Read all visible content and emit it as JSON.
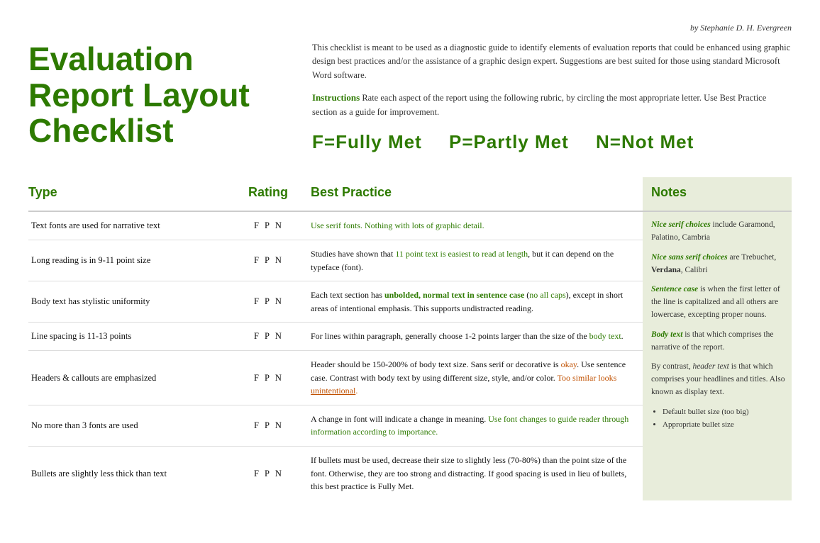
{
  "byline": "by Stephanie D. H. Evergreen",
  "title": {
    "line1": "Evaluation",
    "line2": "Report Layout",
    "line3": "Checklist"
  },
  "intro": {
    "description": "This checklist is meant to be used as a diagnostic guide to identify elements of evaluation reports that could be enhanced using graphic design best practices and/or the assistance of a graphic design expert. Suggestions are best suited for those using standard Microsoft Word software.",
    "instructions_label": "Instructions",
    "instructions_text": " Rate each aspect of the report using the following rubric, by circling the most appropriate letter. Use Best Practice section as a guide for improvement."
  },
  "legend": {
    "f": "F=Fully Met",
    "p": "P=Partly Met",
    "n": "N=Not Met"
  },
  "columns": {
    "type": "Type",
    "rating": "Rating",
    "bp": "Best Practice",
    "notes": "Notes"
  },
  "rows": [
    {
      "type": "Text fonts are used for narrative text",
      "rating": [
        "F",
        "P",
        "N"
      ],
      "bp": "Use serif fonts. Nothing with lots of graphic detail.",
      "bp_green": true
    },
    {
      "type": "Long reading is in 9-11 point size",
      "rating": [
        "F",
        "P",
        "N"
      ],
      "bp": "Studies have shown that 11 point text is easiest to read at length, but it can depend on the typeface (font).",
      "bp_green_partial": "11 point text is easiest to read at length"
    },
    {
      "type": "Body text has stylistic uniformity",
      "rating": [
        "F",
        "P",
        "N"
      ],
      "bp": "Each text section has unbolded, normal text in sentence case (no all caps), except in short areas of intentional emphasis. This supports undistracted reading."
    },
    {
      "type": "Line spacing is 11-13 points",
      "rating": [
        "F",
        "P",
        "N"
      ],
      "bp": "For lines within paragraph, generally choose 1-2 points larger than the size of the body text."
    },
    {
      "type": "Headers & callouts are emphasized",
      "rating": [
        "F",
        "P",
        "N"
      ],
      "bp": "Header should be 150-200% of body text size. Sans serif or decorative is okay. Use sentence case. Contrast with body text by using different size, style, and/or color. Too similar looks unintentional."
    },
    {
      "type": "No more than 3 fonts are used",
      "rating": [
        "F",
        "P",
        "N"
      ],
      "bp": "A change in font will indicate a change in meaning. Use font changes to guide reader through information according to importance."
    },
    {
      "type": "Bullets are slightly less thick than text",
      "rating": [
        "F",
        "P",
        "N"
      ],
      "bp": "If bullets must be used, decrease their size to slightly less (70-80%) than the point size of the font. Otherwise, they are too strong and distracting. If good spacing is used in lieu of bullets, this best practice is Fully Met."
    }
  ],
  "notes_content": [
    {
      "id": "serif_choices",
      "label": "Nice serif choices",
      "label_style": "italic-green",
      "text": " include Garamond, Palatino, Cambria"
    },
    {
      "id": "sans_serif_choices",
      "label": "Nice sans serif choices",
      "label_style": "italic-green",
      "text": " are Trebuchet, Verdana, Calibri"
    },
    {
      "id": "sentence_case",
      "label": "Sentence case",
      "label_style": "italic-green",
      "text": " is when the first letter of the line is capitalized and all others are lowercase, excepting proper nouns."
    },
    {
      "id": "body_text",
      "label": "Body text",
      "label_style": "italic-green",
      "text": " is that which comprises the narrative of the report."
    },
    {
      "id": "header_text",
      "label": "",
      "label_style": "normal",
      "text": "By contrast, header text is that which comprises your headlines and titles. Also known as display text.",
      "header_italic": "header text"
    },
    {
      "id": "bullets_list",
      "label": "",
      "label_style": "list",
      "items": [
        "Default bullet size (too big)",
        "Appropriate bullet size"
      ]
    }
  ]
}
